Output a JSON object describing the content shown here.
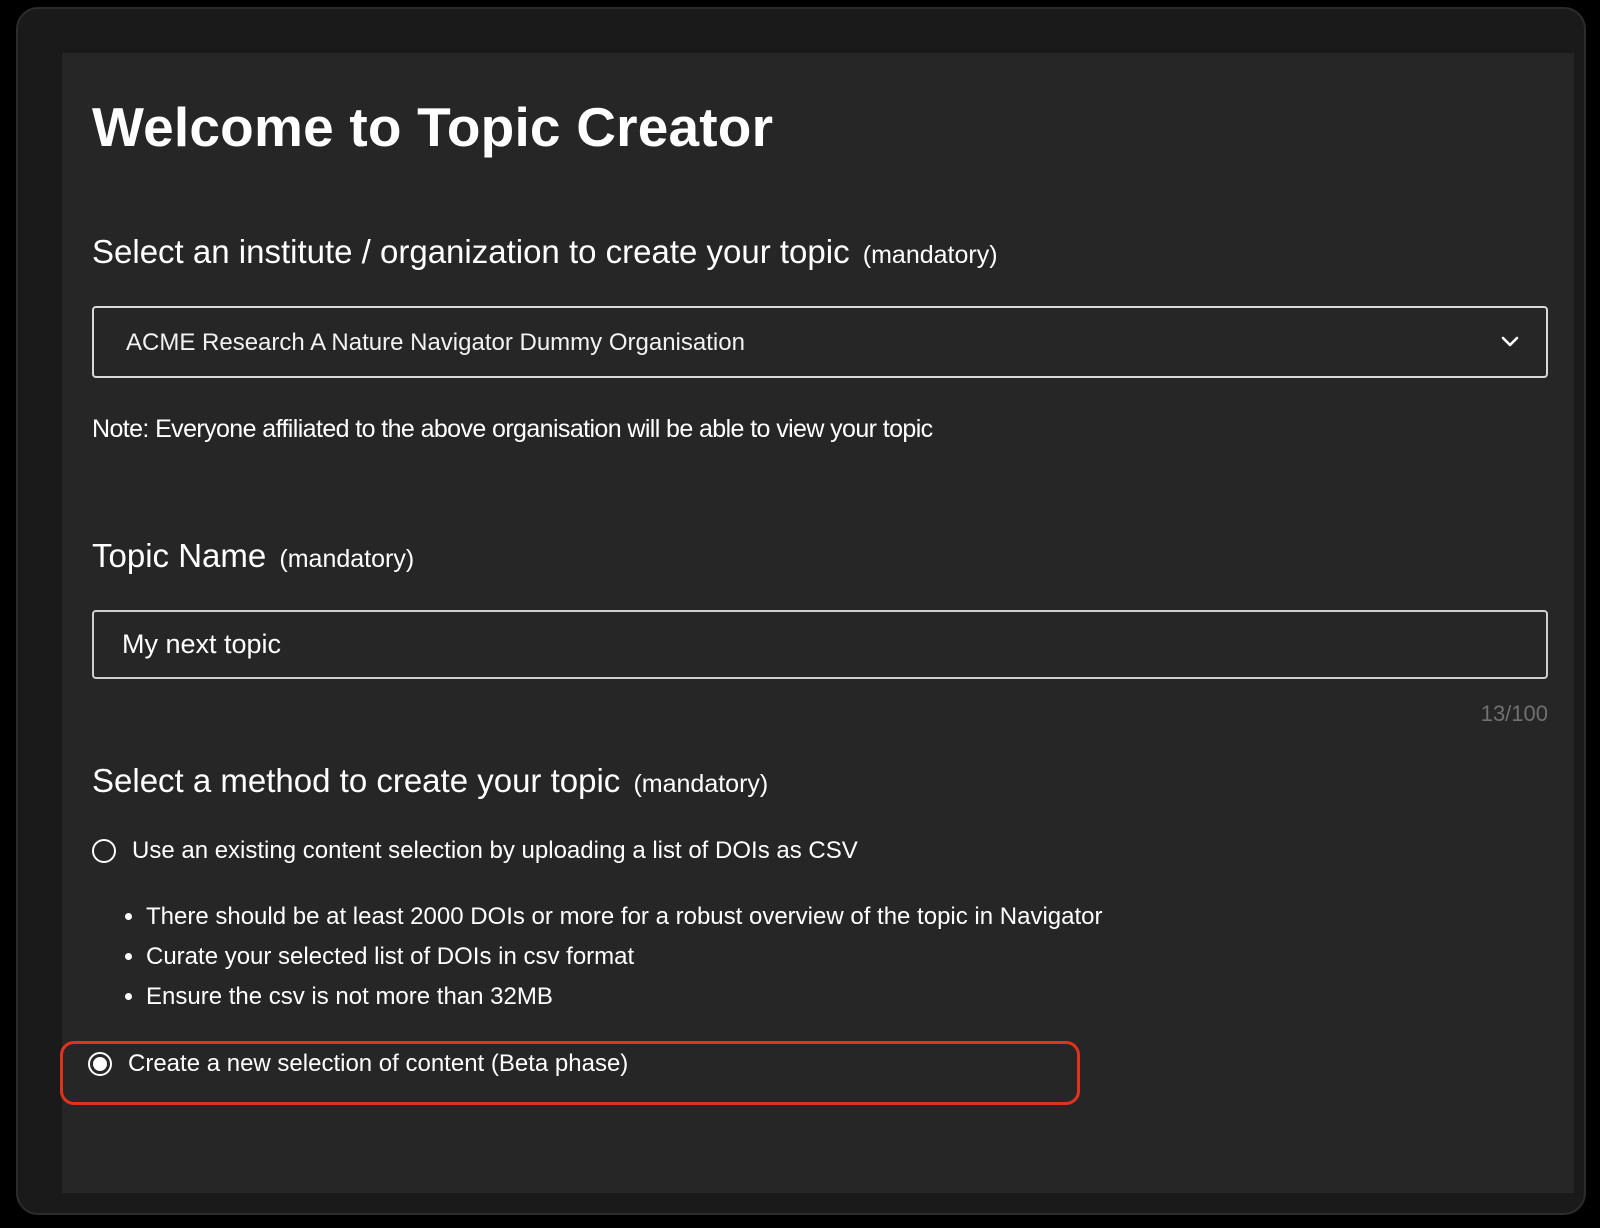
{
  "page": {
    "title": "Welcome to Topic Creator"
  },
  "organization": {
    "heading": "Select an institute / organization to create your topic",
    "mandatory_label": "(mandatory)",
    "selected_value": "ACME Research A Nature Navigator Dummy Organisation",
    "note": "Note: Everyone affiliated to the above organisation will be able to view your topic"
  },
  "topic_name": {
    "heading": "Topic Name",
    "mandatory_label": "(mandatory)",
    "value": "My next topic",
    "counter": "13/100"
  },
  "method": {
    "heading": "Select a method to create your topic",
    "mandatory_label": "(mandatory)",
    "options": [
      {
        "label": "Use an existing content selection by uploading a list of DOIs as CSV",
        "selected": false
      },
      {
        "label": "Create a new selection of content (Beta phase)",
        "selected": true
      }
    ],
    "csv_requirements": [
      "There should be at least 2000 DOIs or more for a robust overview of the topic in Navigator",
      "Curate your selected list of DOIs in csv format",
      "Ensure the csv is not more than 32MB"
    ]
  },
  "colors": {
    "background": "#262626",
    "text": "#ffffff",
    "counter_text": "#707070",
    "highlight_border": "#e0321f"
  },
  "icons": {
    "dropdown": "chevron-down-icon"
  }
}
